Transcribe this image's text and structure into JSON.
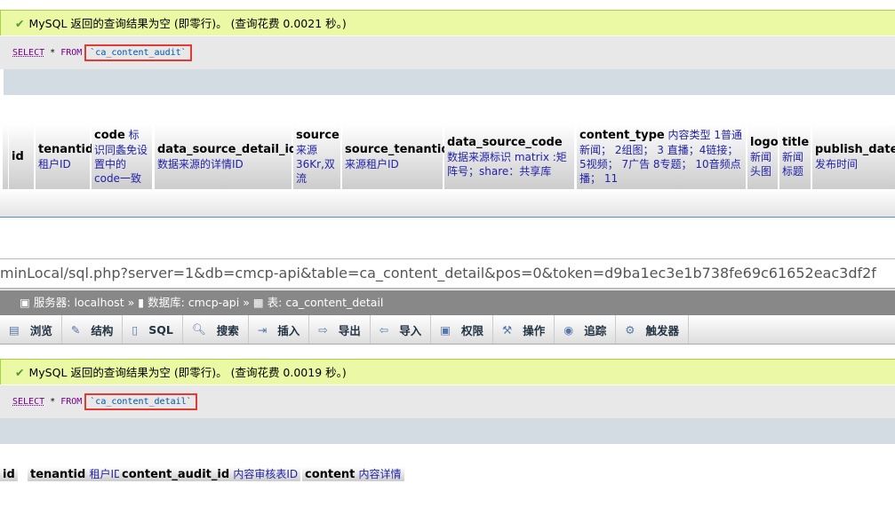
{
  "top": {
    "message": "MySQL 返回的查询结果为空 (即零行)。 (查询花费 0.0021 秒。)",
    "sql_select": "SELECT",
    "sql_mid": "* ",
    "sql_from": "FROM",
    "table": "`ca_content_audit`",
    "columns": [
      {
        "name": "id",
        "comment": ""
      },
      {
        "name": "tenantid",
        "comment": "租户ID"
      },
      {
        "name": "code",
        "comment": "标识同螽免设置中的code一致"
      },
      {
        "name": "data_source_detail_id",
        "comment": "数据来源的详情ID"
      },
      {
        "name": "source",
        "comment": "来源36Kr,双流"
      },
      {
        "name": "source_tenantid",
        "comment": "来源租户ID"
      },
      {
        "name": "data_source_code",
        "comment": "数据来源标识 matrix :矩阵号；share：共享库"
      },
      {
        "name": "content_type",
        "comment": "内容类型 1普通新闻； 2组图； 3 直播；4链接；5视频； 7广告 8专题； 10音频点播； 11"
      },
      {
        "name": "logo",
        "comment": "新闻头图"
      },
      {
        "name": "title",
        "comment": "新闻标题"
      },
      {
        "name": "publish_date",
        "comment": "发布时间"
      }
    ]
  },
  "url": "minLocal/sql.php?server=1&db=cmcp-api&table=ca_content_detail&pos=0&token=d9ba1ec3e1b738fe69c61652eac3df2f",
  "breadcrumb": {
    "server": "服务器: localhost",
    "db": "数据库: cmcp-api",
    "table": "表: ca_content_detail",
    "sep": "»"
  },
  "tabs": [
    {
      "label": "浏览",
      "icon": "table-icon"
    },
    {
      "label": "结构",
      "icon": "structure-icon"
    },
    {
      "label": "SQL",
      "icon": "sql-icon"
    },
    {
      "label": "搜索",
      "icon": "search-icon"
    },
    {
      "label": "插入",
      "icon": "insert-icon"
    },
    {
      "label": "导出",
      "icon": "export-icon"
    },
    {
      "label": "导入",
      "icon": "import-icon"
    },
    {
      "label": "权限",
      "icon": "privileges-icon"
    },
    {
      "label": "操作",
      "icon": "wrench-icon"
    },
    {
      "label": "追踪",
      "icon": "eye-icon"
    },
    {
      "label": "触发器",
      "icon": "trigger-icon"
    }
  ],
  "bottom": {
    "message": "MySQL 返回的查询结果为空 (即零行)。 (查询花费 0.0019 秒。)",
    "sql_select": "SELECT",
    "sql_mid": "* ",
    "sql_from": "FROM",
    "table": "`ca_content_detail`",
    "columns": [
      {
        "name": "id",
        "comment": ""
      },
      {
        "name": "tenantid",
        "comment": "租户ID"
      },
      {
        "name": "content_audit_id",
        "comment": "内容审核表ID"
      },
      {
        "name": "content",
        "comment": "内容详情"
      }
    ]
  }
}
